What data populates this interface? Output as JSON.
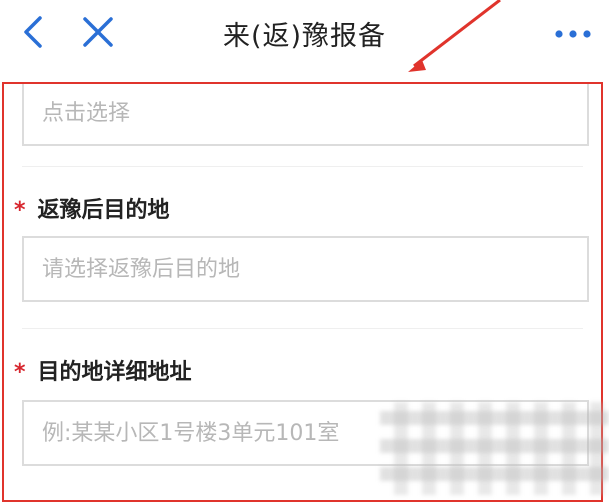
{
  "header": {
    "title": "来(返)豫报备",
    "back_icon": "chevron-left-icon",
    "close_icon": "close-icon",
    "more_icon": "more-horizontal-icon",
    "accent_color": "#2a6fd6"
  },
  "form": {
    "field_top": {
      "placeholder": "点击选择"
    },
    "destination": {
      "label": "返豫后目的地",
      "required_mark": "*",
      "placeholder": "请选择返豫后目的地"
    },
    "address": {
      "label": "目的地详细地址",
      "required_mark": "*",
      "placeholder": "例:某某小区1号楼3单元101室"
    }
  },
  "annotation": {
    "highlight_color": "#e0342c"
  }
}
